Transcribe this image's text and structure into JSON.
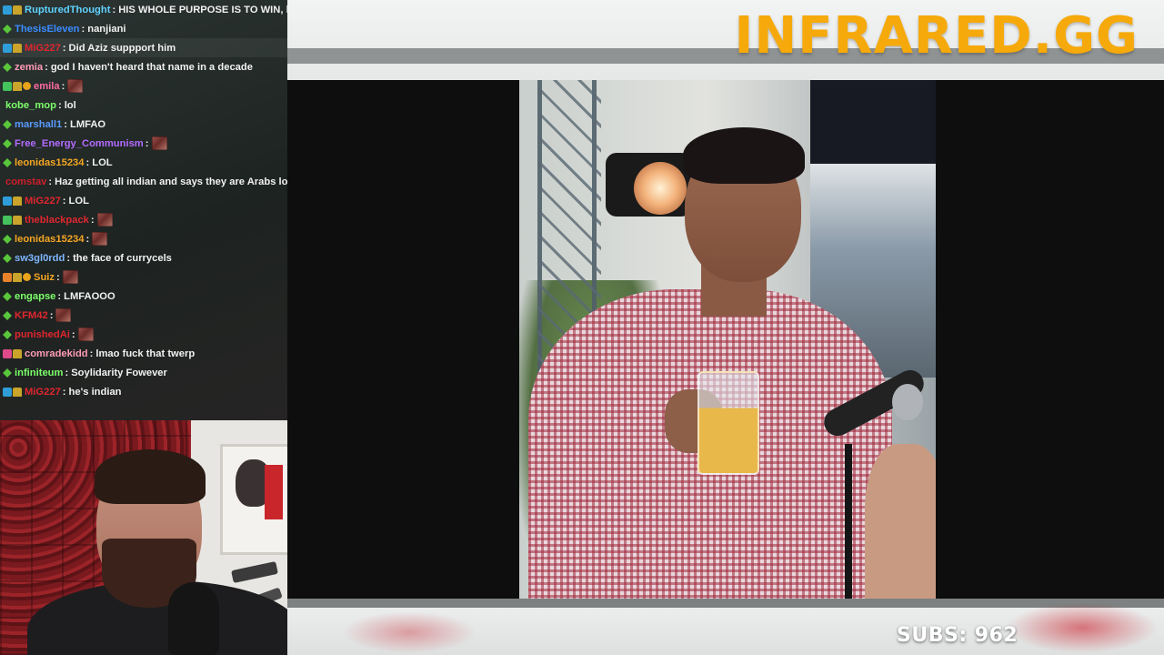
{
  "brand": {
    "title": "INFRARED.GG"
  },
  "chat": {
    "messages": [
      {
        "user": "RupturedThought",
        "color": "#5fd2ff",
        "badges": [
          "b-prime",
          "b-sub"
        ],
        "text": "HIS WHOLE PURPOSE IS TO WIN, he's",
        "emote": false
      },
      {
        "user": "ThesisEleven",
        "color": "#3b8cff",
        "badges": [
          "b-verify"
        ],
        "text": "nanjiani",
        "emote": false
      },
      {
        "user": "MiG227",
        "color": "#e0262f",
        "badges": [
          "b-prime",
          "b-sub"
        ],
        "text": "Did Aziz suppport him",
        "emote": false
      },
      {
        "user": "zemia",
        "color": "#ff9bb6",
        "badges": [
          "b-verify"
        ],
        "text": "god I haven't heard that name in a decade",
        "emote": false
      },
      {
        "user": "emila",
        "color": "#ff6aa1",
        "badges": [
          "b-green",
          "b-sub",
          "b-gift"
        ],
        "text": "",
        "emote": true
      },
      {
        "user": "kobe_mop",
        "color": "#7cff6a",
        "badges": [],
        "text": "lol",
        "emote": false
      },
      {
        "user": "marshall1",
        "color": "#5a9bff",
        "badges": [
          "b-verify"
        ],
        "text": "LMFAO",
        "emote": false
      },
      {
        "user": "Free_Energy_Communism",
        "color": "#b36bff",
        "badges": [
          "b-verify"
        ],
        "text": "",
        "emote": true
      },
      {
        "user": "leonidas15234",
        "color": "#f5a623",
        "badges": [
          "b-verify"
        ],
        "text": "LOL",
        "emote": false
      },
      {
        "user": "comstav",
        "color": "#d01e2c",
        "badges": [],
        "text": "Haz getting all indian and says they are Arabs lol",
        "emote": false
      },
      {
        "user": "MiG227",
        "color": "#e0262f",
        "badges": [
          "b-prime",
          "b-sub"
        ],
        "text": "LOL",
        "emote": false
      },
      {
        "user": "theblackpack",
        "color": "#e0262f",
        "badges": [
          "b-green",
          "b-sub"
        ],
        "text": "",
        "emote": true
      },
      {
        "user": "leonidas15234",
        "color": "#f5a623",
        "badges": [
          "b-verify"
        ],
        "text": "",
        "emote": true
      },
      {
        "user": "sw3gl0rdd",
        "color": "#7fb6ff",
        "badges": [
          "b-verify"
        ],
        "text": "the face of currycels",
        "emote": false
      },
      {
        "user": "Suiz",
        "color": "#f5a623",
        "badges": [
          "b-orange",
          "b-sub",
          "b-gift"
        ],
        "text": "",
        "emote": true
      },
      {
        "user": "engapse",
        "color": "#7cff6a",
        "badges": [
          "b-verify"
        ],
        "text": "LMFAOOO",
        "emote": false
      },
      {
        "user": "KFM42",
        "color": "#e0262f",
        "badges": [
          "b-verify"
        ],
        "text": "",
        "emote": true
      },
      {
        "user": "punishedAi",
        "color": "#e0262f",
        "badges": [
          "b-verify"
        ],
        "text": "",
        "emote": true
      },
      {
        "user": "comradekidd",
        "color": "#ff9bb6",
        "badges": [
          "b-pink",
          "b-sub"
        ],
        "text": "lmao fuck that twerp",
        "emote": false
      },
      {
        "user": "infiniteum",
        "color": "#7cff6a",
        "badges": [
          "b-verify"
        ],
        "text": "Soylidarity Fowever",
        "emote": false
      },
      {
        "user": "MiG227",
        "color": "#e0262f",
        "badges": [
          "b-prime",
          "b-sub"
        ],
        "text": "he's indian",
        "emote": false
      }
    ]
  },
  "footer": {
    "subs_label": "SUBS: 962"
  }
}
